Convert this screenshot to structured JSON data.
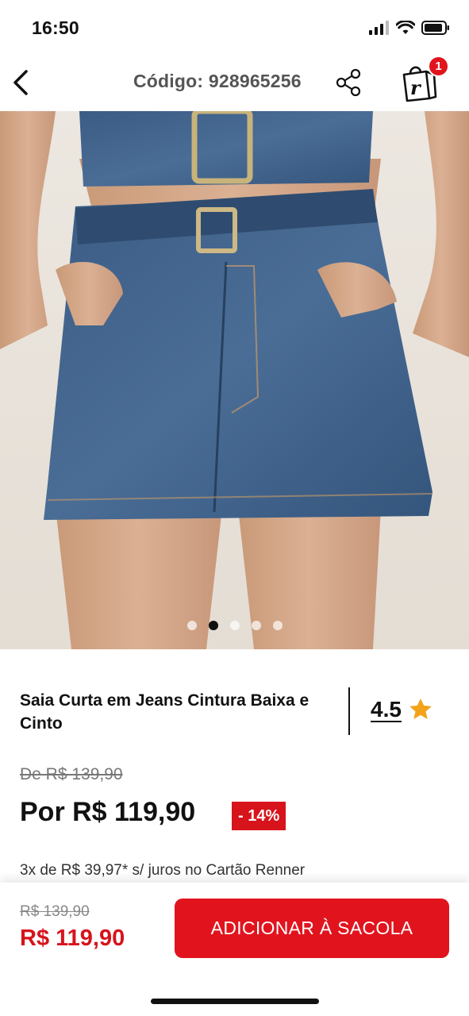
{
  "status_bar": {
    "time": "16:50",
    "icons": [
      "signal-icon",
      "wifi-icon",
      "battery-icon"
    ]
  },
  "header": {
    "back_icon": "chevron-left-icon",
    "product_code": "Código: 928965256",
    "share_icon": "share-icon",
    "bag_icon": "shopping-bag-icon",
    "bag_count": "1"
  },
  "gallery": {
    "image_description_icon": "product-photo",
    "total_images": 5,
    "active_index": 1
  },
  "product": {
    "name": "Saia Curta em Jeans Cintura Baixa e Cinto",
    "rating": "4.5",
    "old_price": "De R$ 139,90",
    "new_price": "Por R$ 119,90",
    "discount": "- 14%",
    "installments": "3x de R$ 39,97* s/ juros no Cartão Renner"
  },
  "bottom_bar": {
    "old_price": "R$ 139,90",
    "new_price": "R$ 119,90",
    "add_button_label": "ADICIONAR À SACOLA"
  },
  "colors": {
    "accent": "#e1141e",
    "star": "#f2a31a",
    "denim": "#3d5f86"
  }
}
